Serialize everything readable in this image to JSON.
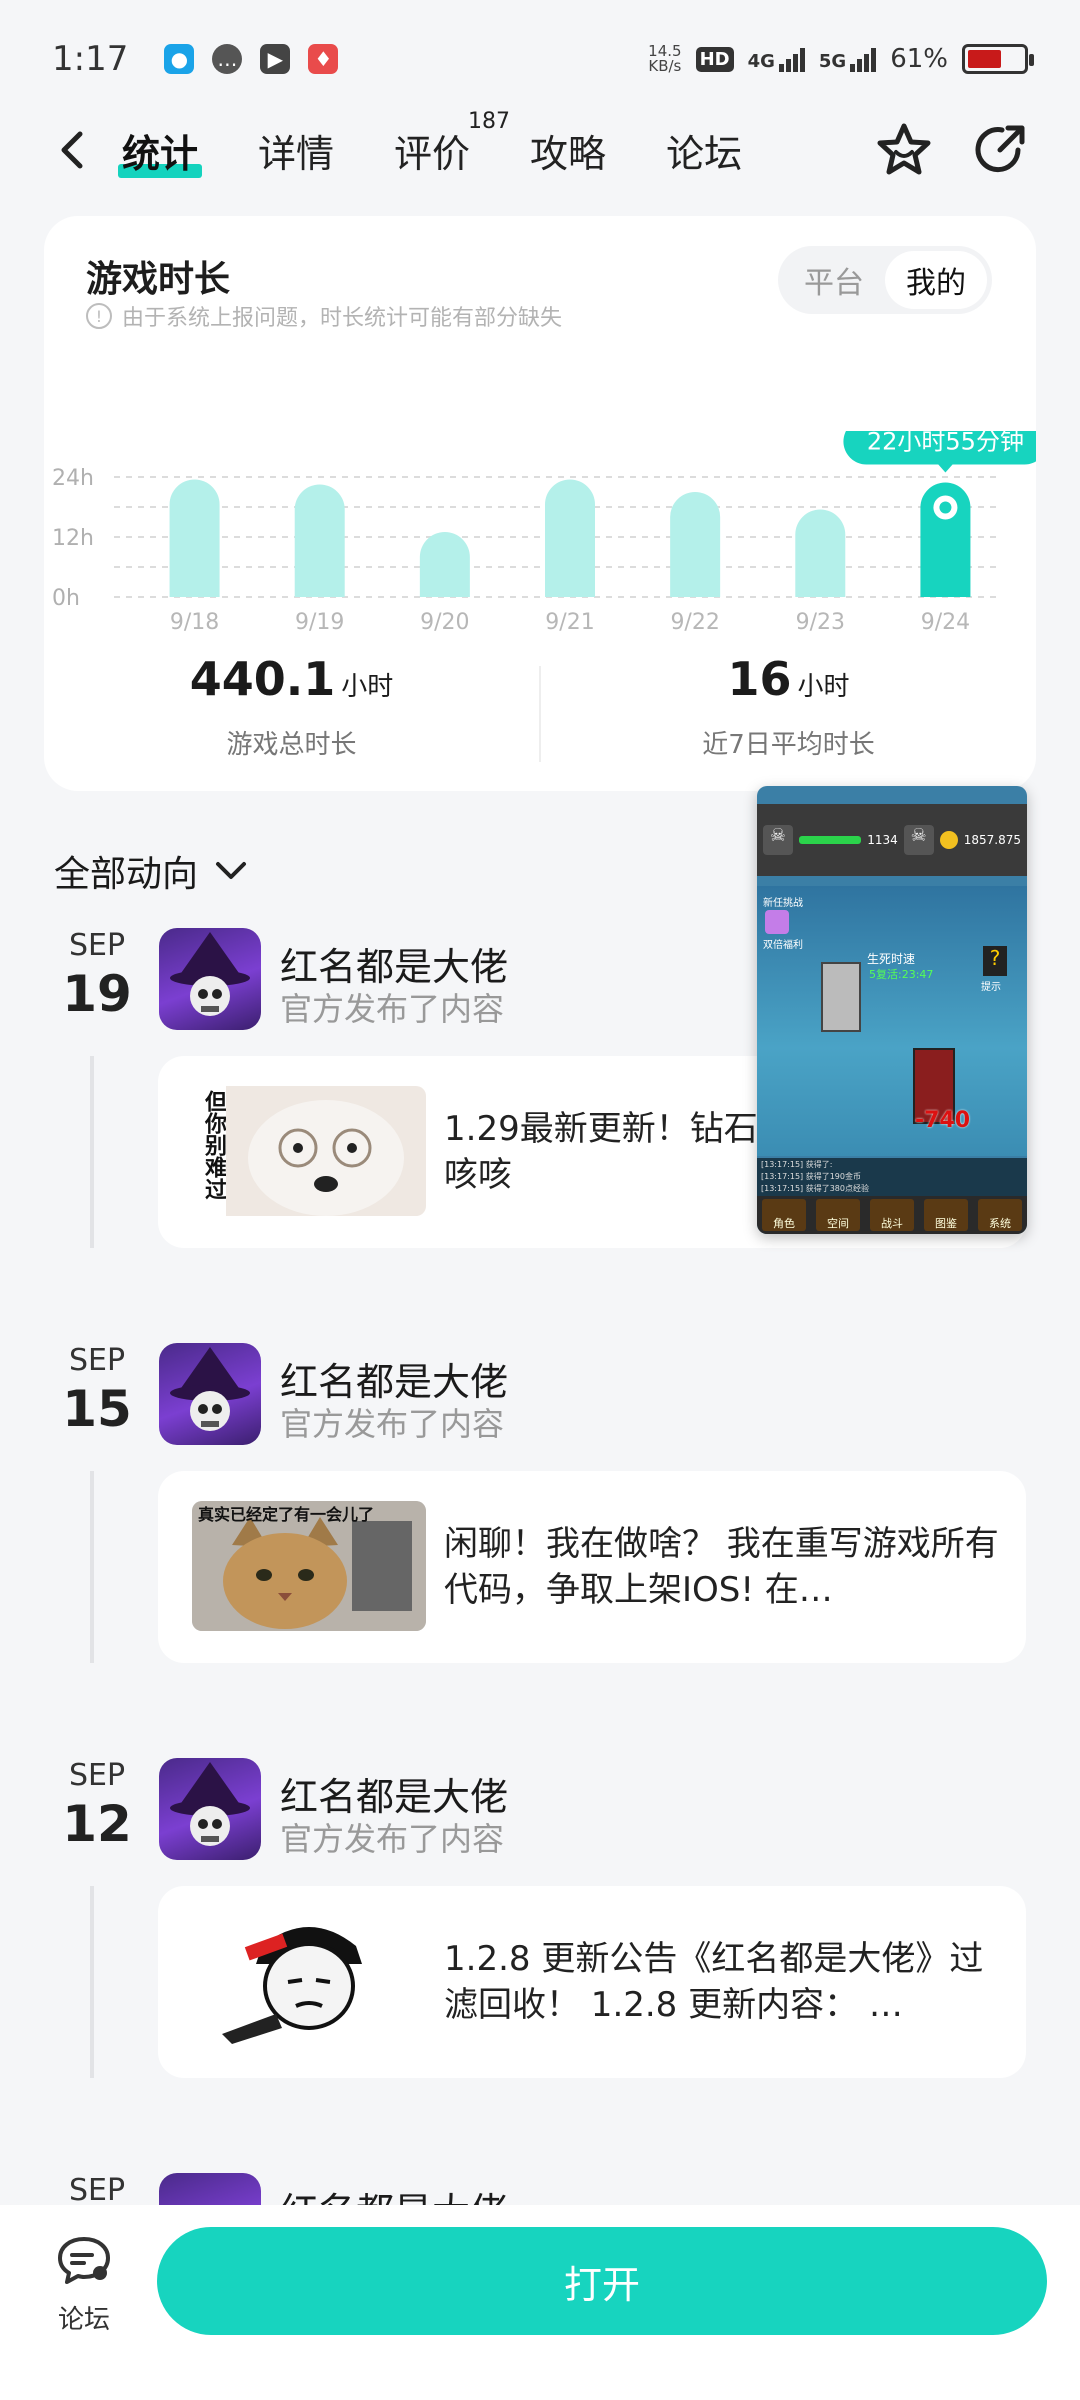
{
  "status_bar": {
    "time": "1:17",
    "net_speed_top": "14.5",
    "net_speed_unit": "KB/s",
    "hd": "HD",
    "net1": "4G",
    "net2": "5G",
    "battery": "61%",
    "battery_level": 0.61
  },
  "nav": {
    "tabs": [
      {
        "label": "统计"
      },
      {
        "label": "详情"
      },
      {
        "label": "评价",
        "badge": "187"
      },
      {
        "label": "攻略"
      },
      {
        "label": "论坛"
      }
    ]
  },
  "playtime": {
    "title": "游戏时长",
    "note": "由于系统上报问题，时长统计可能有部分缺失",
    "toggle": {
      "platform": "平台",
      "mine": "我的"
    },
    "tooltip": "22小时55分钟",
    "total_value": "440.1",
    "total_unit": "小时",
    "total_label": "游戏总时长",
    "avg_value": "16",
    "avg_unit": "小时",
    "avg_label": "近7日平均时长"
  },
  "chart_data": {
    "type": "bar",
    "categories": [
      "9/18",
      "9/19",
      "9/20",
      "9/21",
      "9/22",
      "9/23",
      "9/24"
    ],
    "values": [
      23.5,
      22.5,
      13,
      23.5,
      21,
      17.5,
      22.9
    ],
    "ylabels": [
      "24h",
      "12h",
      "0h"
    ],
    "ylim": [
      0,
      24
    ],
    "highlight_index": 6,
    "colors": {
      "bar": "#b4f0ea",
      "highlight": "#17d4bf"
    }
  },
  "feed": {
    "filter_label": "全部动向",
    "items": [
      {
        "month": "SEP",
        "day": "19",
        "author": "红名都是大佬",
        "action": "官方发布了内容",
        "text": "1.29最新更新！钻石就能拿钻石！ 咳咳",
        "thumb_text": "但你别难过"
      },
      {
        "month": "SEP",
        "day": "15",
        "author": "红名都是大佬",
        "action": "官方发布了内容",
        "text": "闲聊！我在做啥？ 我在重写游戏所有代码，争取上架IOS! 在…",
        "thumb_text": "真实已经定了有一会儿了"
      },
      {
        "month": "SEP",
        "day": "12",
        "author": "红名都是大佬",
        "action": "官方发布了内容",
        "text": "1.2.8 更新公告《红名都是大佬》过滤回收！ 1.2.8 更新内容：  …"
      },
      {
        "month": "SEP",
        "author": "红名都是大佬"
      }
    ]
  },
  "pip": {
    "hp1": "1134",
    "gold": "1857.875",
    "boss_label": "生死时速",
    "timer": "5复活:23:47",
    "damage": "-740",
    "left_tag1": "新任挑战",
    "left_tag2": "双倍福利",
    "right_tag": "提示",
    "log1": "[13:17:15] 获得了:",
    "log2": "[13:17:15] 获得了190金币",
    "log3": "[13:17:15] 获得了380点经验",
    "buttons": [
      "角色",
      "空间",
      "战斗",
      "图鉴",
      "系统"
    ]
  },
  "bottom": {
    "forum_label": "论坛",
    "open_label": "打开"
  }
}
